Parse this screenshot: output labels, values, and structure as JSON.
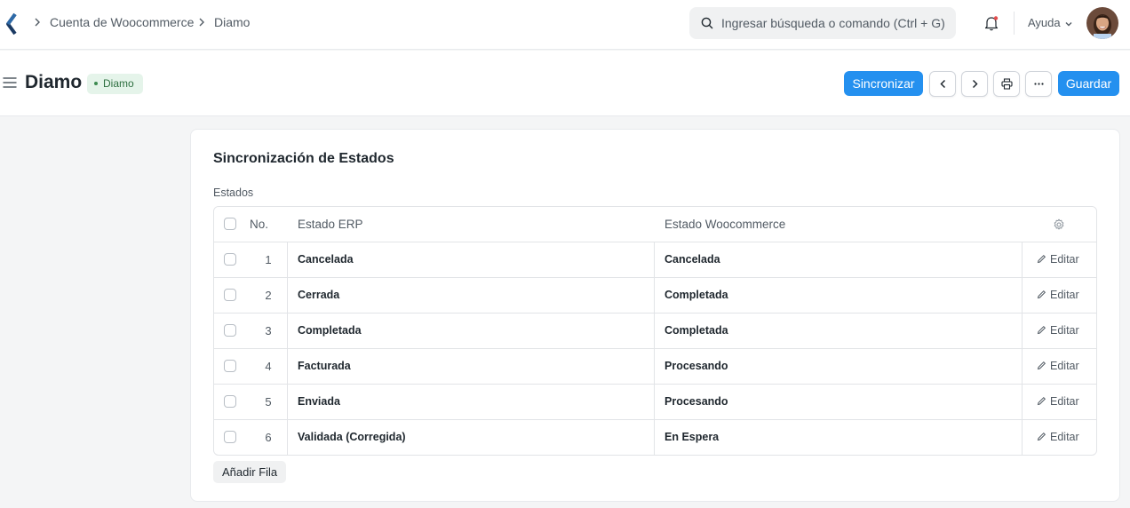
{
  "breadcrumb": {
    "items": [
      "Cuenta de Woocommerce",
      "Diamo"
    ]
  },
  "search": {
    "placeholder": "Ingresar búsqueda o comando (Ctrl + G)"
  },
  "navbar": {
    "help_label": "Ayuda",
    "icons": [
      "app-logo-icon",
      "bell-icon",
      "chevron-down-icon",
      "avatar"
    ]
  },
  "page": {
    "title": "Diamo",
    "status_badge": "Diamo",
    "buttons": {
      "sync": "Sincronizar",
      "save": "Guardar"
    },
    "icon_buttons": [
      "chevron-left-icon",
      "chevron-right-icon",
      "printer-icon",
      "more-icon"
    ]
  },
  "section": {
    "title": "Sincronización de Estados",
    "table_label": "Estados",
    "columns": {
      "no": "No.",
      "erp": "Estado ERP",
      "woo": "Estado Woocommerce"
    },
    "rows": [
      {
        "no": "1",
        "erp": "Cancelada",
        "woo": "Cancelada",
        "edit": "Editar"
      },
      {
        "no": "2",
        "erp": "Cerrada",
        "woo": "Completada",
        "edit": "Editar"
      },
      {
        "no": "3",
        "erp": "Completada",
        "woo": "Completada",
        "edit": "Editar"
      },
      {
        "no": "4",
        "erp": "Facturada",
        "woo": "Procesando",
        "edit": "Editar"
      },
      {
        "no": "5",
        "erp": "Enviada",
        "woo": "Procesando",
        "edit": "Editar"
      },
      {
        "no": "6",
        "erp": "Validada (Corregida)",
        "woo": "En Espera",
        "edit": "Editar"
      }
    ],
    "add_row_label": "Añadir Fila"
  },
  "colors": {
    "primary": "#2490ef",
    "badge_bg": "#e5f4ea",
    "badge_text": "#2e6f40",
    "logo": "#1b3a63",
    "notification_dot": "#e24c4c"
  }
}
